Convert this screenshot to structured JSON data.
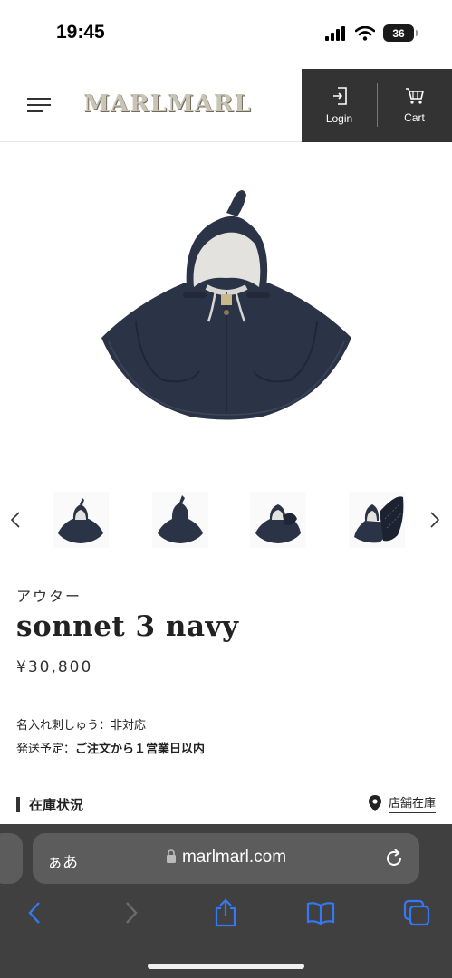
{
  "status": {
    "time": "19:45",
    "battery": "36"
  },
  "header": {
    "logo": "MARLMARL",
    "login_label": "Login",
    "cart_label": "Cart"
  },
  "product": {
    "category": "アウター",
    "name": "sonnet 3 navy",
    "price": "¥30,800",
    "embroidery_label": "名入れ刺しゅう：",
    "embroidery_value": "非対応",
    "shipping_label": "発送予定：",
    "shipping_value": "ご注文から１営業日以内",
    "stock_title": "在庫状況",
    "store_stock_label": "店舗在庫"
  },
  "thumbnails": [
    "thumb-front",
    "thumb-back",
    "thumb-side",
    "thumb-open"
  ],
  "safari": {
    "aa": "ぁあ",
    "url": "marlmarl.com"
  },
  "colors": {
    "navy": "#2b3447",
    "header_dark": "#333333",
    "safari_bg": "#404040",
    "ios_blue": "#3478f6"
  }
}
